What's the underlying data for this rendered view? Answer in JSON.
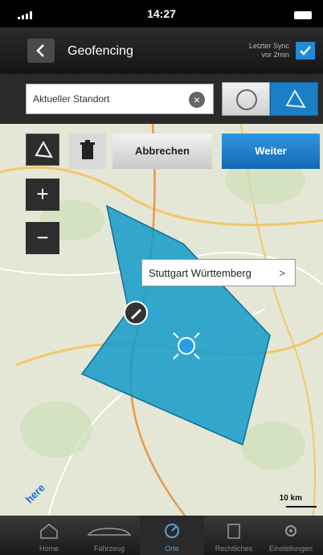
{
  "status_bar": {
    "time": "14:27"
  },
  "header": {
    "title": "Geofencing",
    "sync_label": "Letzter Sync",
    "sync_value": "vor 2min"
  },
  "search": {
    "value": "Aktueller Standort"
  },
  "toolbar": {
    "cancel_label": "Abbrechen",
    "next_label": "Weiter"
  },
  "map": {
    "callout": "Stuttgart Württemberg",
    "callout_arrow": ">",
    "scale": "10 km",
    "logo": "here",
    "polygon_color": "#139ac9"
  },
  "tabbar": {
    "items": [
      {
        "label": "Home",
        "icon": "home-icon"
      },
      {
        "label": "Fahrzeug",
        "icon": "car-icon"
      },
      {
        "label": "Orte",
        "icon": "places-icon"
      },
      {
        "label": "Rechtliches",
        "icon": "document-icon"
      },
      {
        "label": "Einstellungen",
        "icon": "gear-icon"
      }
    ],
    "active_index": 2
  },
  "colors": {
    "accent": "#1b7fc5",
    "header": "#1f1f1f"
  }
}
